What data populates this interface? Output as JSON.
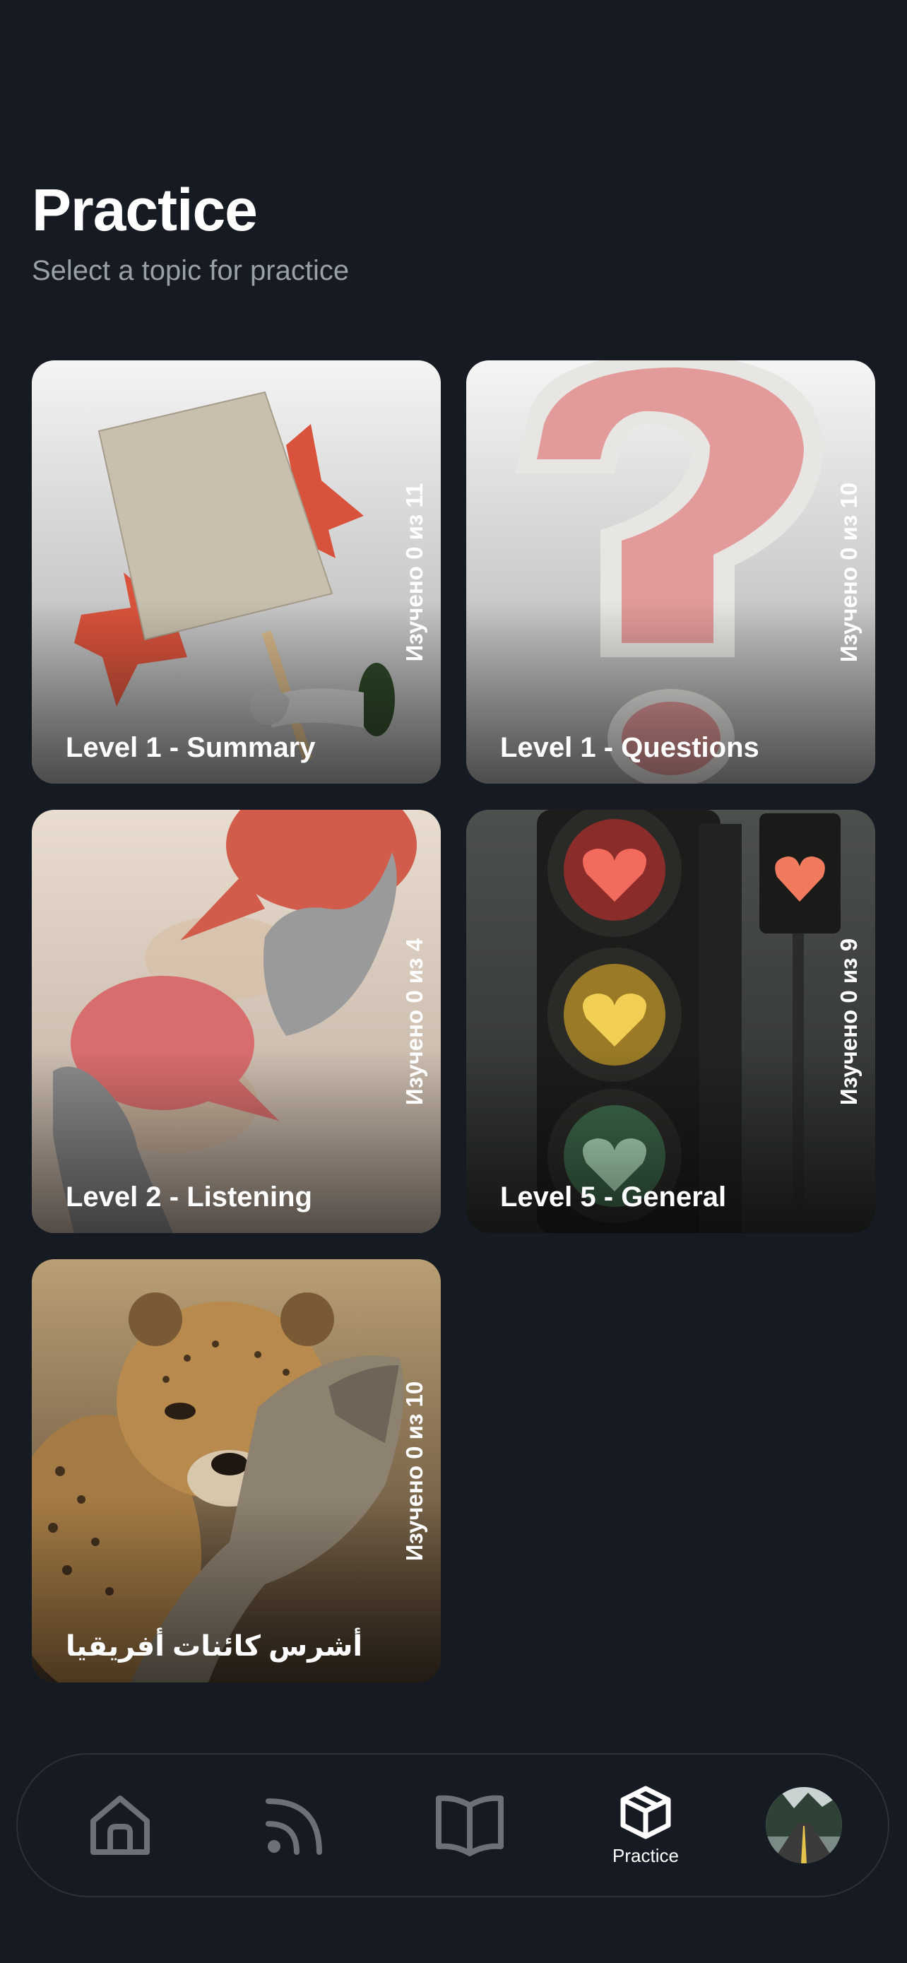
{
  "header": {
    "title": "Practice",
    "subtitle": "Select a topic for practice"
  },
  "topics": [
    {
      "label": "Level 1 - Summary",
      "progress": "Изучено 0 из 11"
    },
    {
      "label": "Level 1 - Questions",
      "progress": "Изучено 0 из 10"
    },
    {
      "label": "Level 2 - Listening",
      "progress": "Изучено 0 из 4"
    },
    {
      "label": "Level 5 - General",
      "progress": "Изучено 0 из 9"
    },
    {
      "label": "أشرس كائنات أفريقيا",
      "progress": "Изучено 0 из 10"
    }
  ],
  "tabbar": {
    "items": [
      {
        "icon": "home-icon",
        "label": ""
      },
      {
        "icon": "feed-icon",
        "label": ""
      },
      {
        "icon": "book-icon",
        "label": ""
      },
      {
        "icon": "cube-icon",
        "label": "Practice",
        "active": true
      },
      {
        "icon": "avatar",
        "label": ""
      }
    ]
  },
  "colors": {
    "background": "#161a22",
    "subtitle": "#9aa0aa",
    "inactive_icon": "#6b7079",
    "active_icon": "#ffffff"
  }
}
